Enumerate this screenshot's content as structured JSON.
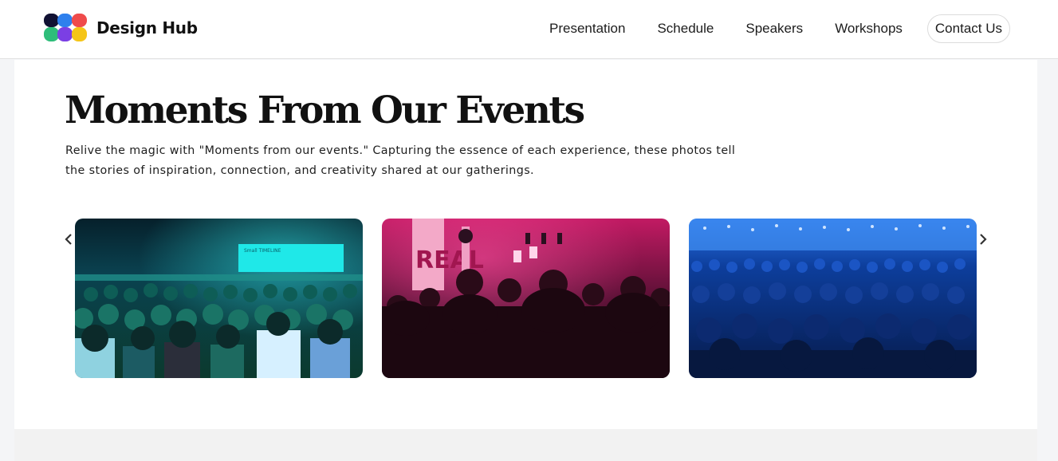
{
  "header": {
    "brand_name": "Design Hub",
    "logo_icon": "multicolor-blob-logo",
    "nav": [
      "Presentation",
      "Schedule",
      "Speakers",
      "Workshops"
    ],
    "contact_label": "Contact Us"
  },
  "section": {
    "title": "Moments From Our Events",
    "description": "Relive the magic with \"Moments from our events.\" Capturing the essence of each experience, these photos tell the stories of inspiration, connection, and creativity shared at our gatherings."
  },
  "carousel": {
    "prev_icon": "chevron-left-icon",
    "next_icon": "chevron-right-icon",
    "photos": [
      {
        "screen_text": "Small TIMELINE",
        "tint": "#1fd6d0"
      },
      {
        "screen_text": "REAL",
        "tint": "#d41e6a"
      },
      {
        "screen_text": "",
        "tint": "#1560d8"
      }
    ]
  },
  "colors": {
    "text": "#111111",
    "border": "#dcdcdc",
    "panel": "#ffffff",
    "background": "#f4f5f7"
  }
}
